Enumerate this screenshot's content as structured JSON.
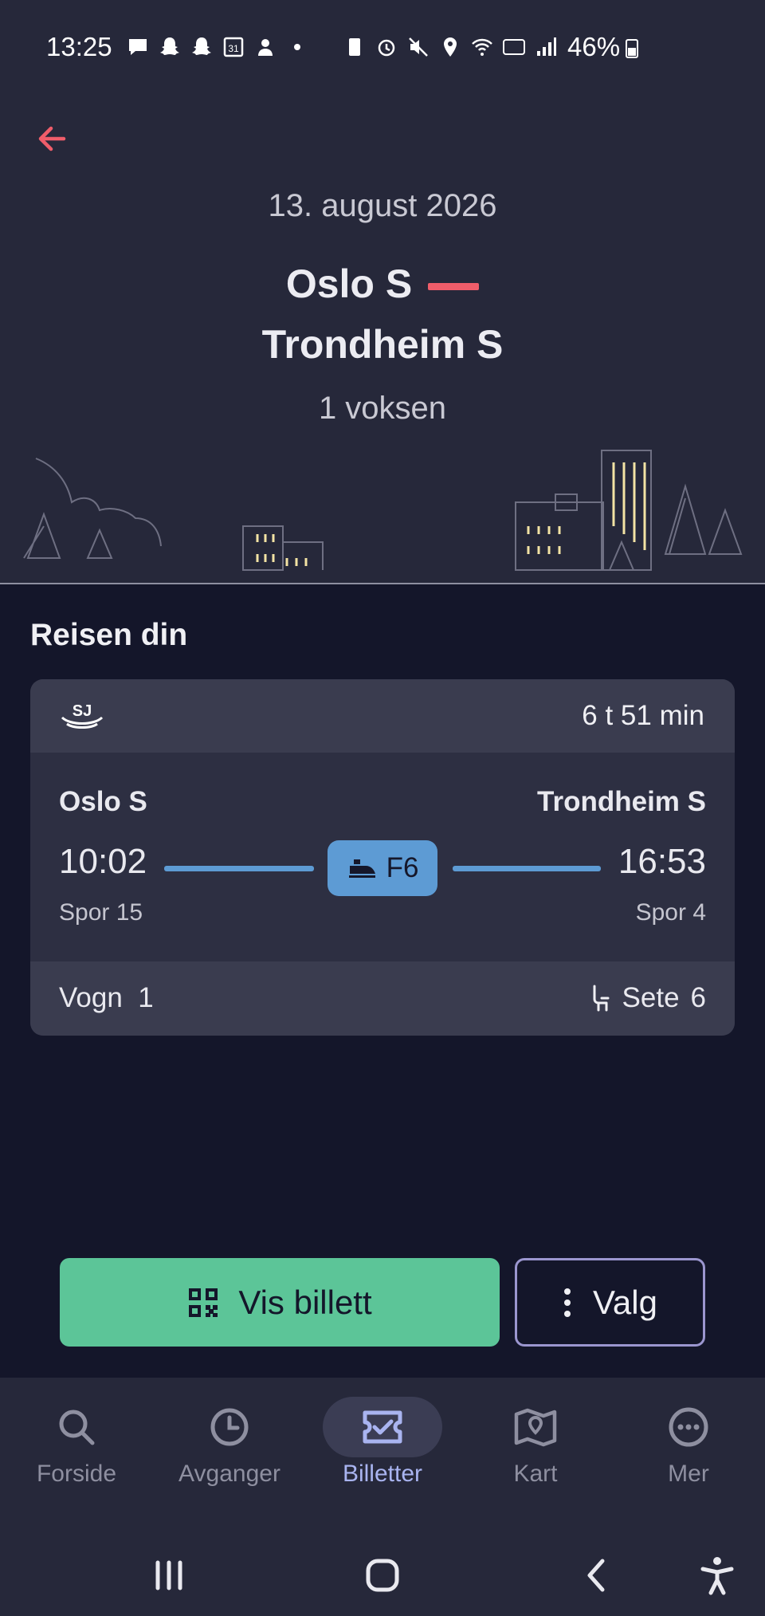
{
  "status_bar": {
    "time": "13:25",
    "battery_pct": "46%",
    "icons_left": [
      "message-icon",
      "snapchat-icon",
      "snapchat-icon",
      "calendar-icon",
      "hand-icon",
      "dot-icon"
    ],
    "icons_right": [
      "battery-saver-icon",
      "alarm-icon",
      "mute-icon",
      "location-icon",
      "wifi-icon",
      "volte-icon",
      "signal-icon",
      "battery-icon"
    ]
  },
  "header": {
    "date": "13. august 2026",
    "origin": "Oslo S",
    "destination": "Trondheim S",
    "passengers": "1 voksen",
    "accent_color": "#ef5d6a"
  },
  "journey": {
    "section_title": "Reisen din",
    "operator_logo": "sj-logo",
    "duration": "6 t 51 min",
    "from": "Oslo S",
    "to": "Trondheim S",
    "departure": "10:02",
    "arrival": "16:53",
    "from_track": "Spor 15",
    "to_track": "Spor 4",
    "train": "F6",
    "car_label": "Vogn",
    "car": "1",
    "seat_label": "Sete",
    "seat": "6"
  },
  "actions": {
    "show_ticket": "Vis billett",
    "options": "Valg",
    "primary_color": "#5cc598"
  },
  "nav": {
    "items": [
      {
        "label": "Forside",
        "icon": "search-icon"
      },
      {
        "label": "Avganger",
        "icon": "clock-icon"
      },
      {
        "label": "Billetter",
        "icon": "ticket-icon"
      },
      {
        "label": "Kart",
        "icon": "map-icon"
      },
      {
        "label": "Mer",
        "icon": "more-icon"
      }
    ],
    "active": "Billetter"
  }
}
